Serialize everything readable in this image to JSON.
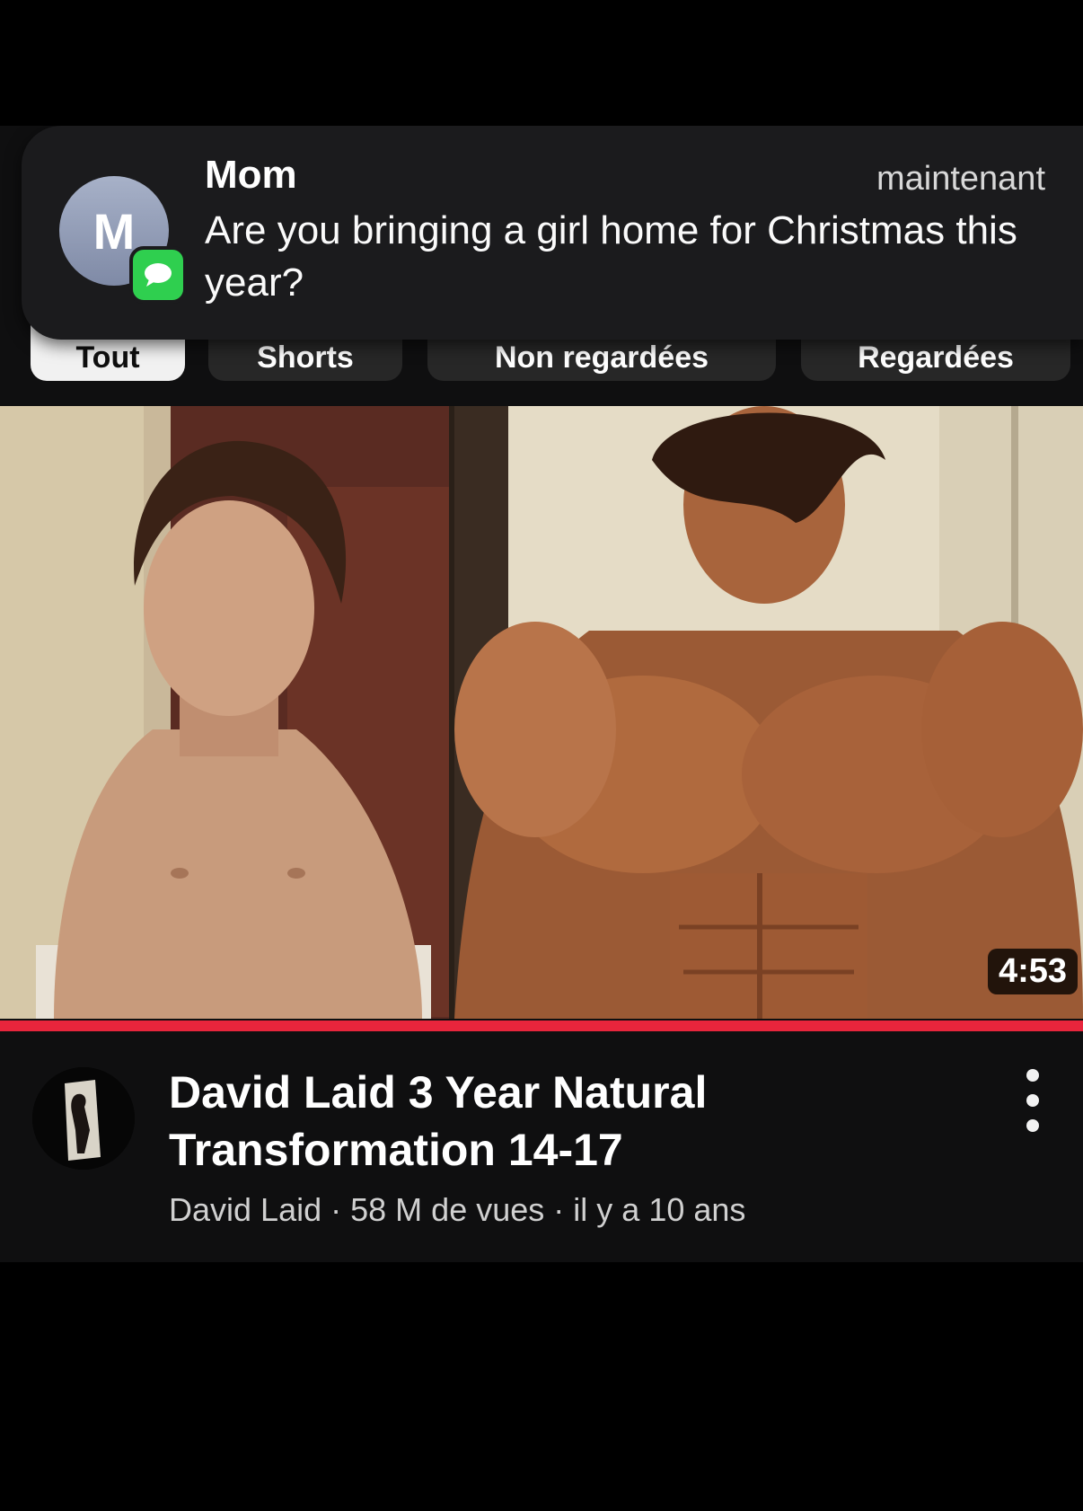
{
  "notification": {
    "avatar_letter": "M",
    "sender": "Mom",
    "time": "maintenant",
    "message": "Are you bringing a girl home for Christmas this year?",
    "app_icon": "messages-icon"
  },
  "filter_chips": [
    {
      "label": "Tout",
      "active": true
    },
    {
      "label": "Shorts",
      "active": false
    },
    {
      "label": "Non regardées",
      "active": false
    },
    {
      "label": "Regardées",
      "active": false
    }
  ],
  "video": {
    "duration": "4:53",
    "watched_progress": 1.0,
    "title": "David Laid 3 Year Natural Transformation 14-17",
    "channel": "David Laid",
    "views": "58 M de vues",
    "age": "il y a 10 ans",
    "separator": "·"
  },
  "colors": {
    "background": "#0f0f10",
    "progress": "#e8253c",
    "notification_bg": "#1b1b1d",
    "messages_green": "#2fcf4f"
  }
}
